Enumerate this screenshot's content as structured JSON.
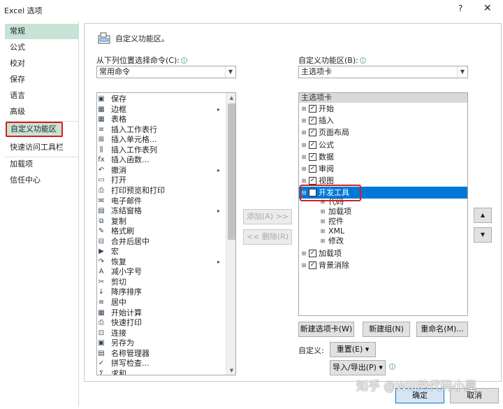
{
  "window": {
    "title": "Excel 选项",
    "help": "?",
    "close": "✕"
  },
  "sidebar": {
    "items": [
      {
        "label": "常规"
      },
      {
        "label": "公式"
      },
      {
        "label": "校对"
      },
      {
        "label": "保存"
      },
      {
        "label": "语言"
      },
      {
        "label": "高级"
      },
      {
        "label": "自定义功能区"
      },
      {
        "label": "快速访问工具栏"
      },
      {
        "label": "加载项"
      },
      {
        "label": "信任中心"
      }
    ]
  },
  "header": {
    "title": "自定义功能区。"
  },
  "left": {
    "label": "从下列位置选择命令(C):",
    "combo": "常用命令",
    "commands": [
      {
        "icon": "save-icon",
        "g": "▣",
        "label": "保存",
        "sub": ""
      },
      {
        "icon": "border-icon",
        "g": "▦",
        "label": "边框",
        "sub": "▸"
      },
      {
        "icon": "table-icon",
        "g": "▦",
        "label": "表格",
        "sub": ""
      },
      {
        "icon": "insert-rows-icon",
        "g": "≡",
        "label": "插入工作表行",
        "sub": ""
      },
      {
        "icon": "insert-cells-icon",
        "g": "⊞",
        "label": "插入单元格...",
        "sub": ""
      },
      {
        "icon": "insert-columns-icon",
        "g": "⫼",
        "label": "插入工作表列",
        "sub": ""
      },
      {
        "icon": "function-icon",
        "g": "fx",
        "label": "插入函数...",
        "sub": ""
      },
      {
        "icon": "undo-icon",
        "g": "↶",
        "label": "撤消",
        "sub": "▸"
      },
      {
        "icon": "open-icon",
        "g": "▭",
        "label": "打开",
        "sub": ""
      },
      {
        "icon": "print-preview-icon",
        "g": "⎙",
        "label": "打印预览和打印",
        "sub": ""
      },
      {
        "icon": "email-icon",
        "g": "✉",
        "label": "电子邮件",
        "sub": ""
      },
      {
        "icon": "freeze-panes-icon",
        "g": "▤",
        "label": "冻结窗格",
        "sub": "▸"
      },
      {
        "icon": "copy-icon",
        "g": "⧉",
        "label": "复制",
        "sub": ""
      },
      {
        "icon": "format-painter-icon",
        "g": "✎",
        "label": "格式刷",
        "sub": ""
      },
      {
        "icon": "merge-center-icon",
        "g": "⊟",
        "label": "合并后居中",
        "sub": ""
      },
      {
        "icon": "macro-icon",
        "g": "▶",
        "label": "宏",
        "sub": ""
      },
      {
        "icon": "redo-icon",
        "g": "↷",
        "label": "恢复",
        "sub": "▸"
      },
      {
        "icon": "decrease-font-icon",
        "g": "A",
        "label": "减小字号",
        "sub": ""
      },
      {
        "icon": "cut-icon",
        "g": "✂",
        "label": "剪切",
        "sub": ""
      },
      {
        "icon": "sort-desc-icon",
        "g": "↓",
        "label": "降序排序",
        "sub": ""
      },
      {
        "icon": "center-icon",
        "g": "≡",
        "label": "居中",
        "sub": ""
      },
      {
        "icon": "calculate-icon",
        "g": "▦",
        "label": "开始计算",
        "sub": ""
      },
      {
        "icon": "quick-print-icon",
        "g": "⎙",
        "label": "快速打印",
        "sub": ""
      },
      {
        "icon": "connections-icon",
        "g": "⊡",
        "label": "连接",
        "sub": ""
      },
      {
        "icon": "save-as-icon",
        "g": "▣",
        "label": "另存为",
        "sub": ""
      },
      {
        "icon": "name-manager-icon",
        "g": "▤",
        "label": "名称管理器",
        "sub": ""
      },
      {
        "icon": "spelling-icon",
        "g": "✓",
        "label": "拼写检查...",
        "sub": ""
      },
      {
        "icon": "sum-icon",
        "g": "Σ",
        "label": "求和",
        "sub": ""
      }
    ]
  },
  "middle": {
    "add": "添加(A) >>",
    "remove": "<< 删除(R)"
  },
  "right": {
    "label": "自定义功能区(B):",
    "combo": "主选项卡",
    "tree_header": "主选项卡",
    "tree": [
      {
        "label": "开始",
        "exp": "⊞",
        "checked": "✓",
        "level": 0
      },
      {
        "label": "插入",
        "exp": "⊞",
        "checked": "✓",
        "level": 0
      },
      {
        "label": "页面布局",
        "exp": "⊞",
        "checked": "✓",
        "level": 0
      },
      {
        "label": "公式",
        "exp": "⊞",
        "checked": "✓",
        "level": 0
      },
      {
        "label": "数据",
        "exp": "⊞",
        "checked": "✓",
        "level": 0
      },
      {
        "label": "审阅",
        "exp": "⊞",
        "checked": "✓",
        "level": 0
      },
      {
        "label": "视图",
        "exp": "⊞",
        "checked": "✓",
        "level": 0
      },
      {
        "label": "开发工具",
        "exp": "⊟",
        "checked": "",
        "level": 0,
        "selected": true
      },
      {
        "label": "代码",
        "exp": "⊞",
        "checked": null,
        "level": 1
      },
      {
        "label": "加载项",
        "exp": "⊞",
        "checked": null,
        "level": 1
      },
      {
        "label": "控件",
        "exp": "⊞",
        "checked": null,
        "level": 1
      },
      {
        "label": "XML",
        "exp": "⊞",
        "checked": null,
        "level": 1
      },
      {
        "label": "修改",
        "exp": "⊞",
        "checked": null,
        "level": 1
      },
      {
        "label": "加载项",
        "exp": "⊞",
        "checked": "✓",
        "level": 0
      },
      {
        "label": "背景消除",
        "exp": "⊞",
        "checked": "✓",
        "level": 0
      }
    ],
    "new_tab": "新建选项卡(W)",
    "new_group": "新建组(N)",
    "rename": "重命名(M)...",
    "customize_label": "自定义:",
    "reset": "重置(E) ▾",
    "import_export": "导入/导出(P) ▾",
    "move_up": "▲",
    "move_down": "▼"
  },
  "footer": {
    "ok": "确定",
    "cancel": "取消"
  },
  "watermark": "知乎 @Will的代码小屋"
}
